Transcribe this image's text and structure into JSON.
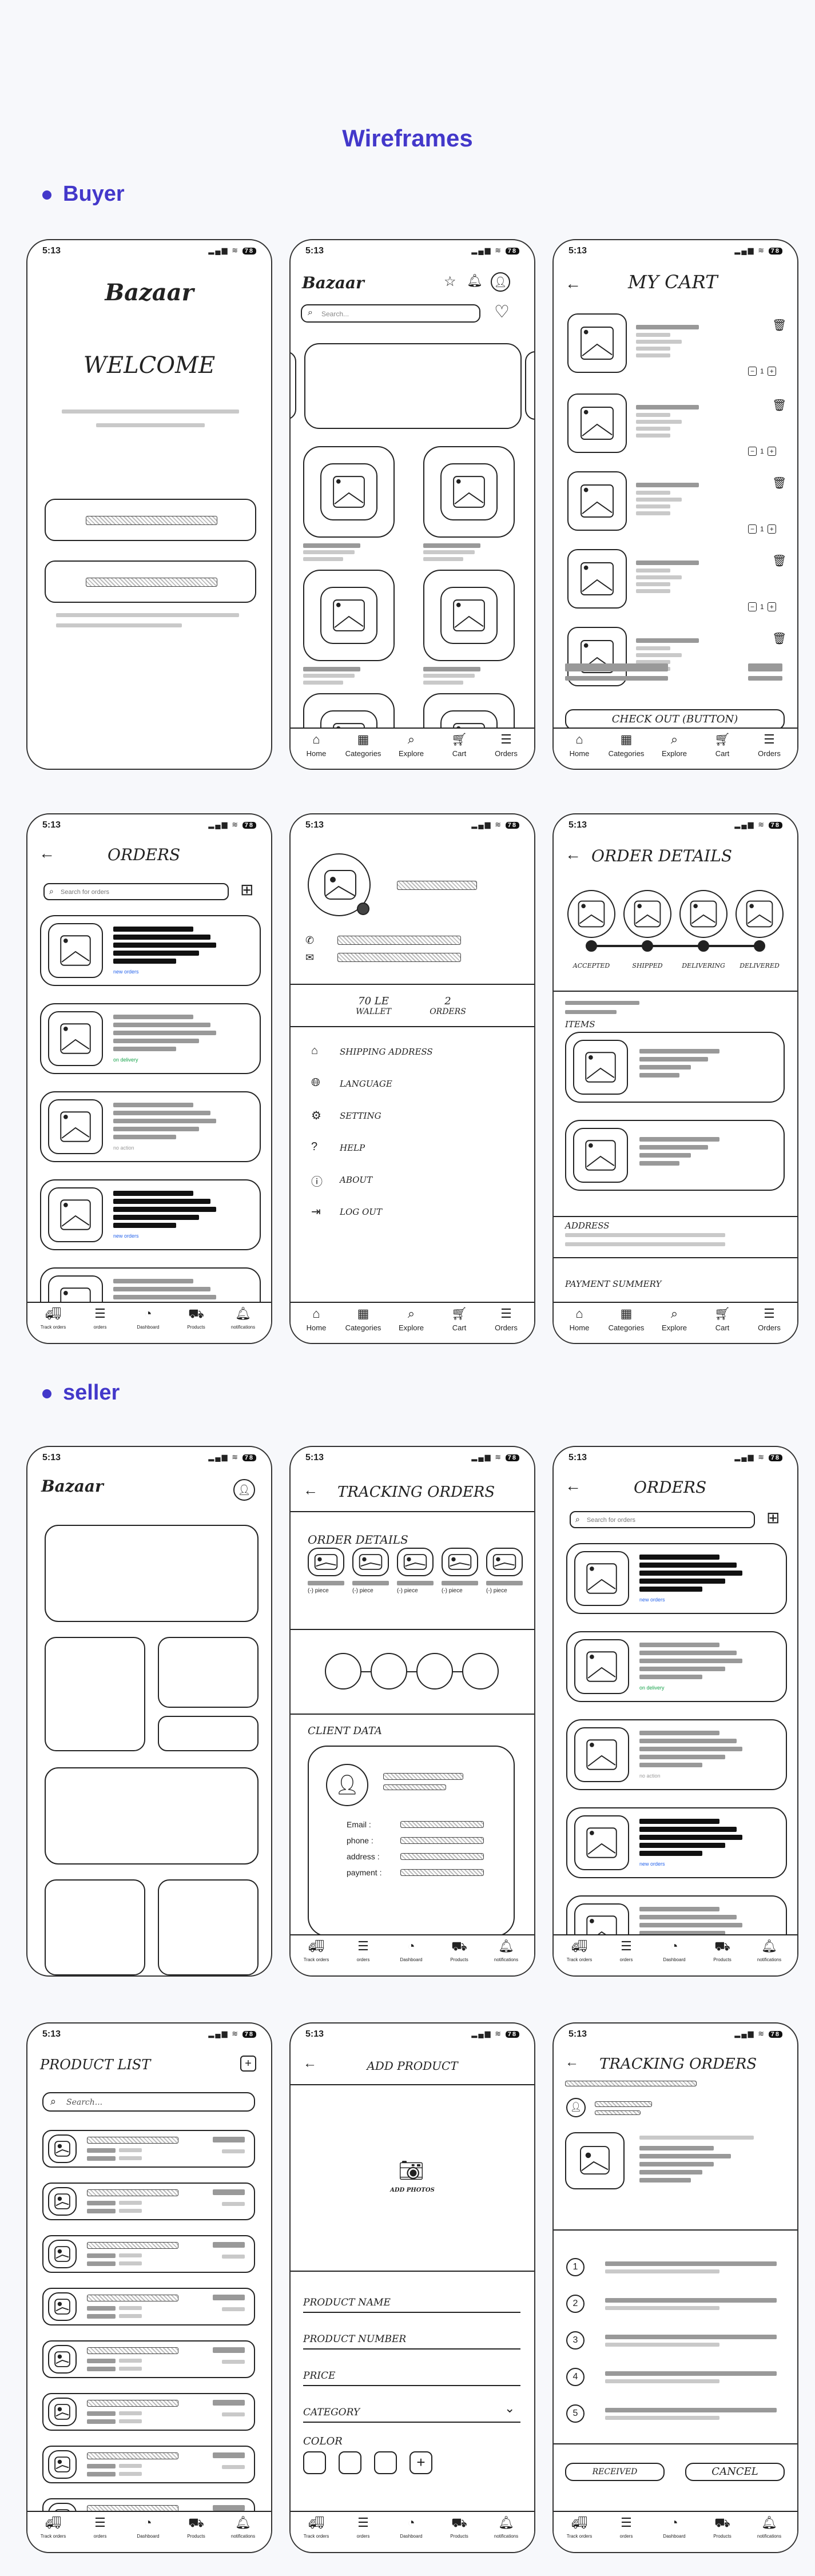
{
  "page": {
    "title": "Wireframes",
    "section_buyer": "Buyer",
    "section_seller": "seller"
  },
  "status": {
    "time": "5:13",
    "battery": "78"
  },
  "bazaar": "Bazaar",
  "welcome": "WELCOME",
  "home": {
    "search_placeholder": "Search..."
  },
  "cart": {
    "title": "MY CART",
    "checkout": "CHECK OUT (BUTTON)",
    "qty": "1"
  },
  "buyer_nav": [
    "Home",
    "Categories",
    "Explore",
    "Cart",
    "Orders"
  ],
  "seller_nav": [
    "Track orders",
    "orders",
    "Dashboard",
    "Products",
    "notifications"
  ],
  "orders": {
    "title": "ORDERS",
    "search_placeholder": "Search for orders",
    "status_green": "on delivery",
    "status_grey": "no action",
    "status_blue": "new orders"
  },
  "profile": {
    "wallet_value": "70 LE",
    "wallet_label": "WALLET",
    "orders_value": "2",
    "orders_label": "ORDERS",
    "menu": [
      "SHIPPING ADDRESS",
      "LANGUAGE",
      "SETTING",
      "HELP",
      "ABOUT",
      "LOG OUT"
    ]
  },
  "order_details": {
    "title": "ORDER DETAILS",
    "steps": [
      "ACCEPTED",
      "SHIPPED",
      "DELIVERING",
      "DELIVERED"
    ],
    "items": "ITEMS",
    "address": "ADDRESS",
    "payment": "PAYMENT SUMMERY"
  },
  "tracking": {
    "title": "TRACKING ORDERS",
    "order_details": "ORDER DETAILS",
    "piece": "(-) piece",
    "client_data": "CLIENT DATA",
    "fields": [
      "Email :",
      "phone :",
      "address :",
      "payment :"
    ]
  },
  "product_list": {
    "title": "PRODUCT LIST",
    "search_placeholder": "Search..."
  },
  "add_product": {
    "title": "ADD PRODUCT",
    "add_photos": "ADD PHOTOS",
    "fields": [
      "PRODUCT NAME",
      "PRODUCT NUMBER",
      "PRICE",
      "CATEGORY"
    ],
    "color": "COLOR"
  },
  "tracking2": {
    "title": "TRACKING ORDERS",
    "steps": [
      "1",
      "2",
      "3",
      "4",
      "5"
    ],
    "received": "RECEIVED",
    "cancel": "CANCEL"
  }
}
